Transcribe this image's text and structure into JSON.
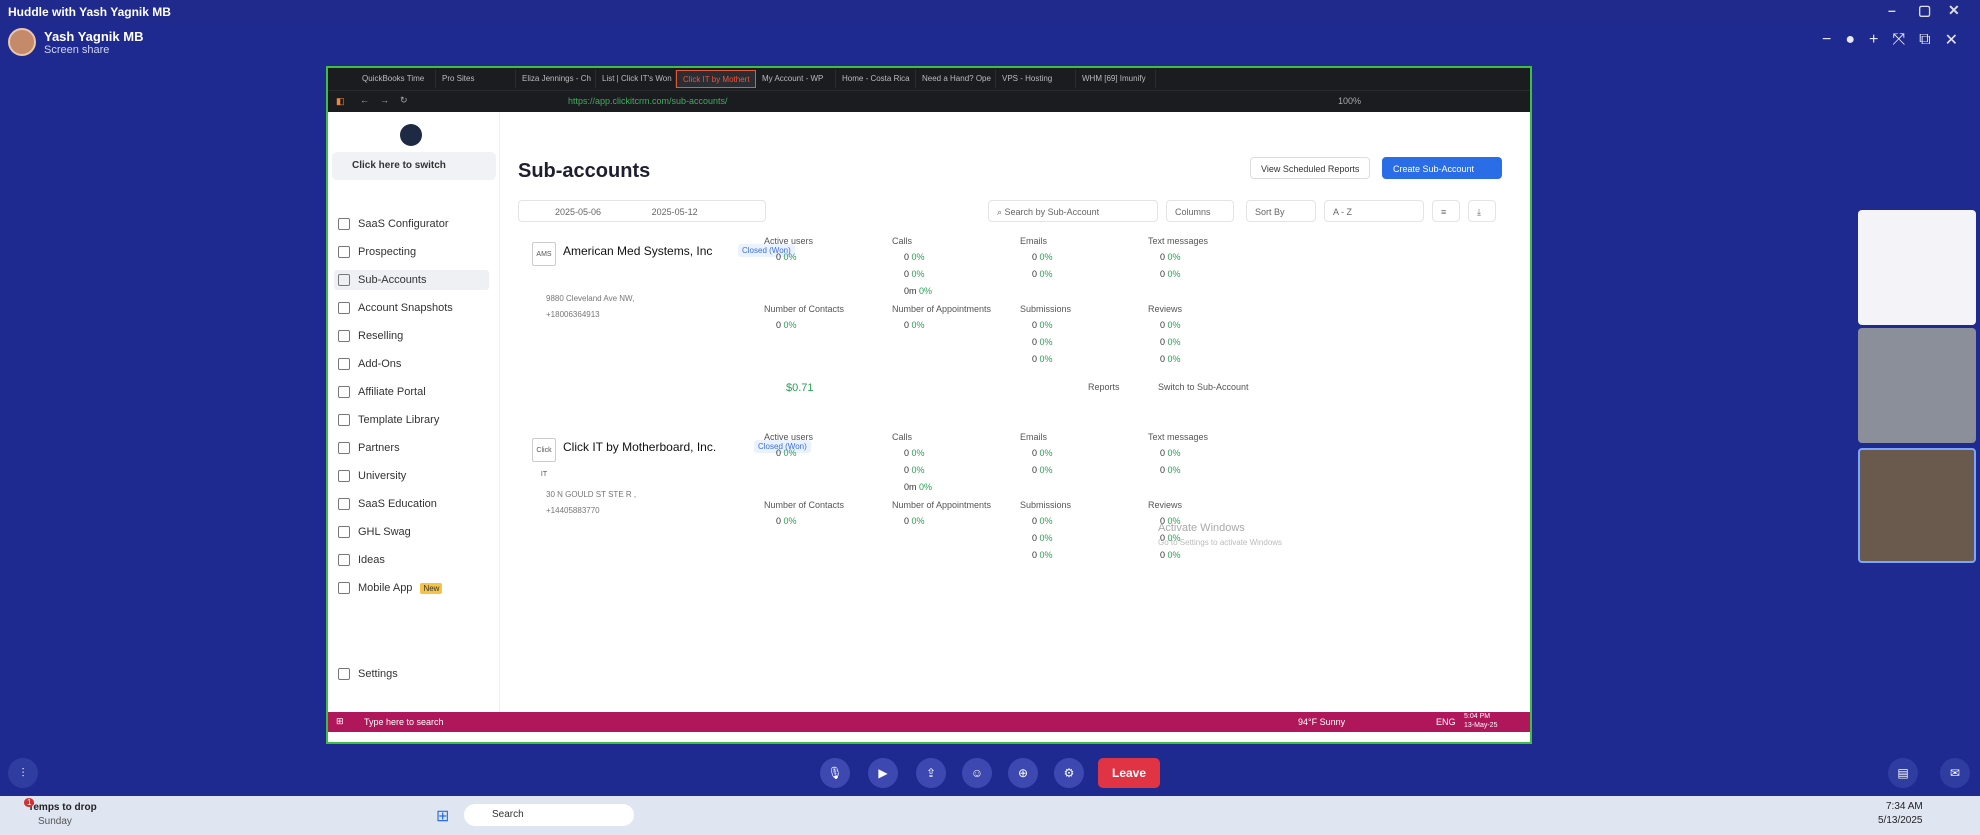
{
  "window": {
    "title": "Huddle with Yash Yagnik MB"
  },
  "presenter": {
    "name": "Yash Yagnik MB",
    "subtitle": "Screen share"
  },
  "browser": {
    "tabs": [
      "QuickBooks Time",
      "Pro Sites",
      "Eliza Jennings - Ch",
      "List | Click IT's Won",
      "Click IT by Mothert",
      "My Account - WP",
      "Home - Costa Rica",
      "Need a Hand? Ope",
      "VPS - Hosting",
      "WHM [69] Imunify"
    ],
    "active_tab": 4,
    "url": "https://app.clickitcrm.com/sub-accounts/",
    "zoom": "100%"
  },
  "sidebar": {
    "switch_label": "Click here to switch",
    "items": [
      "SaaS Configurator",
      "Prospecting",
      "Sub-Accounts",
      "Account Snapshots",
      "Reselling",
      "Add-Ons",
      "Affiliate Portal",
      "Template Library",
      "Partners",
      "University",
      "SaaS Education",
      "GHL Swag",
      "Ideas",
      "Mobile App"
    ],
    "new_badge": "New",
    "settings": "Settings"
  },
  "main": {
    "title": "Sub-accounts",
    "view_reports": "View Scheduled Reports",
    "create": "Create Sub-Account",
    "date_from": "2025-05-06",
    "date_to": "2025-05-12",
    "search_placeholder": "Search by Sub-Account",
    "columns": "Columns",
    "sort_by": "Sort By",
    "sort_value": "A - Z",
    "reports": "Reports",
    "switch_sub": "Switch to Sub-Account",
    "wallet": "$0.71"
  },
  "labels": {
    "active_users": "Active users",
    "calls": "Calls",
    "emails": "Emails",
    "text": "Text messages",
    "contacts": "Number of Contacts",
    "appointments": "Number of Appointments",
    "submissions": "Submissions",
    "reviews": "Reviews"
  },
  "accounts": [
    {
      "name": "American Med Systems, Inc",
      "badge": "Closed (Won)",
      "logo": "AMS",
      "address": "9880 Cleveland Ave NW,",
      "phone": "+18006364913"
    },
    {
      "name": "Click IT by Motherboard, Inc.",
      "badge": "Closed (Won)",
      "logo": "Click IT",
      "address": "30 N GOULD ST STE R ,",
      "phone": "+14405883770"
    }
  ],
  "stats": {
    "zero": "0",
    "pct": "0%",
    "min": "0m"
  },
  "inner_taskbar": {
    "search": "Type here to search",
    "weather": "94°F Sunny",
    "lang": "ENG",
    "time": "5:04 PM",
    "date": "13-May-25"
  },
  "watermark": {
    "title": "Activate Windows",
    "sub": "Go to Settings to activate Windows"
  },
  "huddle_bar": {
    "leave": "Leave"
  },
  "os_taskbar": {
    "weather_title": "Temps to drop",
    "weather_sub": "Sunday",
    "search": "Search",
    "time": "7:34 AM",
    "date": "5/13/2025",
    "badge": "1"
  },
  "colors": {
    "huddle": "#1f2a90",
    "accent": "#2b6de6",
    "leave": "#e03344",
    "positive": "#2a9d55"
  }
}
